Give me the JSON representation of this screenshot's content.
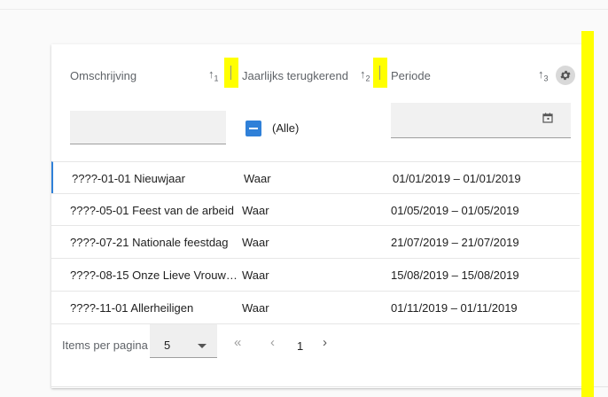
{
  "table": {
    "columns": [
      {
        "label": "Omschrijving",
        "sort_index": "1"
      },
      {
        "label": "Jaarlijks terugkerend",
        "sort_index": "2"
      },
      {
        "label": "Periode",
        "sort_index": "3"
      }
    ],
    "filters": {
      "checkbox_label": "(Alle)"
    },
    "rows": [
      {
        "omschrijving": "????-01-01 Nieuwjaar",
        "terugkerend": "Waar",
        "periode": "01/01/2019 – 01/01/2019"
      },
      {
        "omschrijving": "????-05-01 Feest van de arbeid",
        "terugkerend": "Waar",
        "periode": "01/05/2019 – 01/05/2019"
      },
      {
        "omschrijving": "????-07-21 Nationale feestdag",
        "terugkerend": "Waar",
        "periode": "21/07/2019 – 21/07/2019"
      },
      {
        "omschrijving": "????-08-15 Onze Lieve Vrouw…",
        "terugkerend": "Waar",
        "periode": "15/08/2019 – 15/08/2019"
      },
      {
        "omschrijving": "????-11-01 Allerheiligen",
        "terugkerend": "Waar",
        "periode": "01/11/2019 – 01/11/2019"
      }
    ]
  },
  "pager": {
    "items_label": "Items per pagina",
    "page_size": "5",
    "first_glyph": "«",
    "prev_glyph": "‹",
    "current_page": "1",
    "next_glyph": "›"
  },
  "colors": {
    "accent": "#2f80d8",
    "highlight": "#ffff00"
  },
  "icons": [
    "sort-icon",
    "gear-icon",
    "calendar-icon",
    "chevron-down-icon"
  ]
}
